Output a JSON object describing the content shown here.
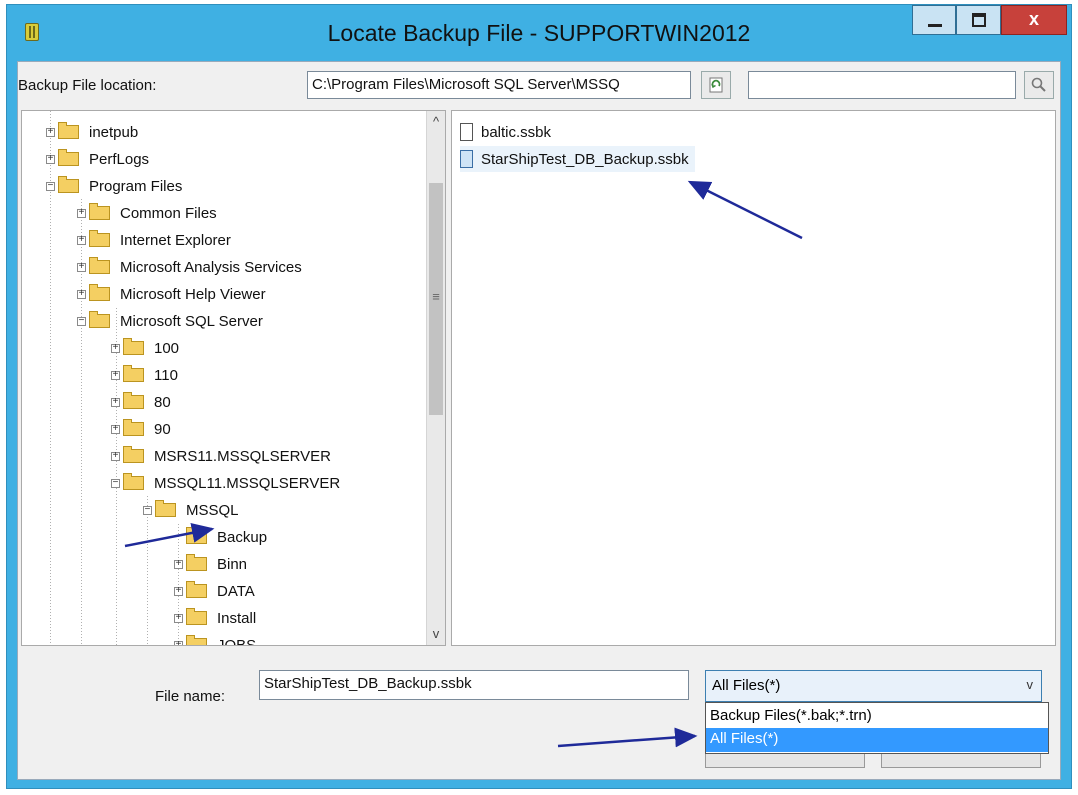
{
  "window": {
    "title": "Locate Backup File - SUPPORTWIN2012",
    "close_glyph": "x"
  },
  "location": {
    "label": "Backup File location:",
    "path": "C:\\Program Files\\Microsoft SQL Server\\MSSQ",
    "search_value": ""
  },
  "tree": [
    {
      "label": "inetpub",
      "expander": "+",
      "depth": 0
    },
    {
      "label": "PerfLogs",
      "expander": "+",
      "depth": 0
    },
    {
      "label": "Program Files",
      "expander": "−",
      "depth": 0
    },
    {
      "label": "Common Files",
      "expander": "+",
      "depth": 1
    },
    {
      "label": "Internet Explorer",
      "expander": "+",
      "depth": 1
    },
    {
      "label": "Microsoft Analysis Services",
      "expander": "+",
      "depth": 1
    },
    {
      "label": "Microsoft Help Viewer",
      "expander": "+",
      "depth": 1
    },
    {
      "label": "Microsoft SQL Server",
      "expander": "−",
      "depth": 1
    },
    {
      "label": "100",
      "expander": "+",
      "depth": 2
    },
    {
      "label": "110",
      "expander": "+",
      "depth": 2
    },
    {
      "label": "80",
      "expander": "+",
      "depth": 2
    },
    {
      "label": "90",
      "expander": "+",
      "depth": 2
    },
    {
      "label": "MSRS11.MSSQLSERVER",
      "expander": "+",
      "depth": 2
    },
    {
      "label": "MSSQL11.MSSQLSERVER",
      "expander": "−",
      "depth": 2
    },
    {
      "label": "MSSQL",
      "expander": "−",
      "depth": 3
    },
    {
      "label": "Backup",
      "expander": "",
      "depth": 4
    },
    {
      "label": "Binn",
      "expander": "+",
      "depth": 4
    },
    {
      "label": "DATA",
      "expander": "+",
      "depth": 4
    },
    {
      "label": "Install",
      "expander": "+",
      "depth": 4
    },
    {
      "label": "JOBS",
      "expander": "+",
      "depth": 4
    }
  ],
  "files": [
    {
      "name": "baltic.ssbk",
      "selected": false
    },
    {
      "name": "StarShipTest_DB_Backup.ssbk",
      "selected": true
    }
  ],
  "file_name": {
    "label": "File name:",
    "value": "StarShipTest_DB_Backup.ssbk"
  },
  "filter": {
    "selected": "All Files(*)",
    "options": [
      "Backup Files(*.bak;*.trn)",
      "All Files(*)"
    ],
    "highlighted_index": 1
  },
  "colors": {
    "title_bar": "#3fb0e3",
    "close_button": "#c7413b",
    "highlight": "#3399ff",
    "annotation_arrow": "#1f2a99"
  }
}
